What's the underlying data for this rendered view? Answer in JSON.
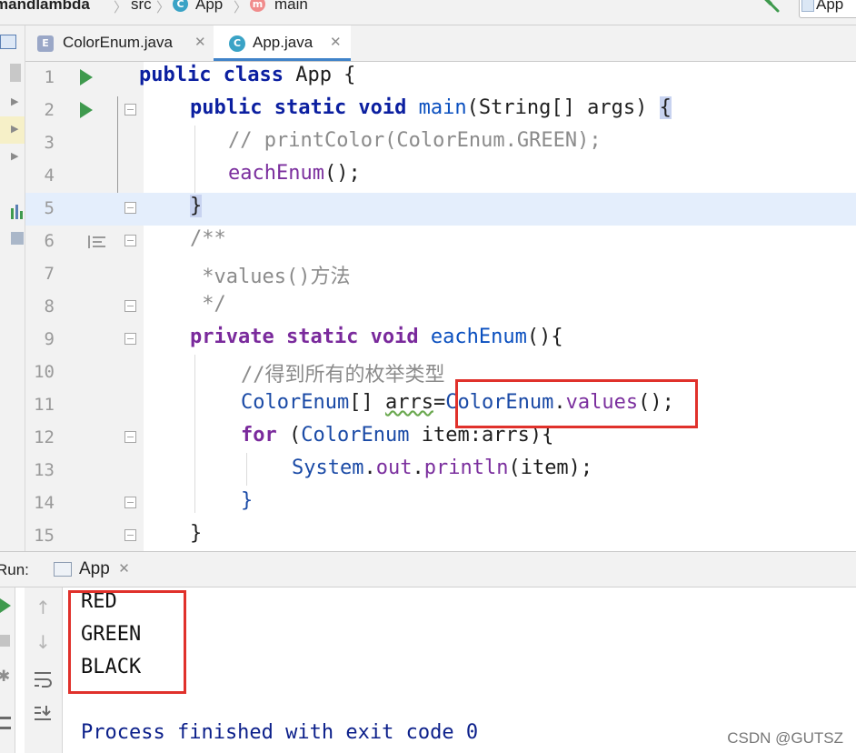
{
  "breadcrumb": {
    "items": [
      "mandlambda",
      "src",
      "App",
      "main"
    ]
  },
  "toolbar": {
    "run_config_label": "App"
  },
  "tabs": [
    {
      "label": "ColorEnum.java",
      "icon": "enum-icon",
      "active": false
    },
    {
      "label": "App.java",
      "icon": "class-icon",
      "active": true
    }
  ],
  "editor": {
    "lines": [
      {
        "n": "1"
      },
      {
        "n": "2"
      },
      {
        "n": "3"
      },
      {
        "n": "4"
      },
      {
        "n": "5"
      },
      {
        "n": "6"
      },
      {
        "n": "7"
      },
      {
        "n": "8"
      },
      {
        "n": "9"
      },
      {
        "n": "10"
      },
      {
        "n": "11"
      },
      {
        "n": "12"
      },
      {
        "n": "13"
      },
      {
        "n": "14"
      },
      {
        "n": "15"
      }
    ],
    "code": {
      "l1_kw": "public class",
      "l1_rest": " App {",
      "l2_kw": "public static void",
      "l2_fn": "main",
      "l2_rest": "(String[] args) ",
      "l2_brace": "{",
      "l3": "// printColor(ColorEnum.GREEN);",
      "l4_fn": "eachEnum",
      "l4_rest": "();",
      "l5": "}",
      "l6": "/**",
      "l7": " *values()方法",
      "l8": " */",
      "l9_kw": "private static void",
      "l9_fn": "eachEnum",
      "l9_rest": "(){",
      "l10": "//得到所有的枚举类型",
      "l11_type": "ColorEnum",
      "l11_a": "[] ",
      "l11_var": "arrs",
      "l11_b": "=",
      "l11_cls": "ColorEnum",
      "l11_dot": ".",
      "l11_m": "values",
      "l11_end": "();",
      "l12_kw": "for",
      "l12_a": " (",
      "l12_type": "ColorEnum",
      "l12_b": " item:arrs){",
      "l13_cls": "System",
      "l13_dot": ".",
      "l13_fld": "out",
      "l13_dot2": ".",
      "l13_m": "println",
      "l13_end": "(item);",
      "l14": "}",
      "l15": "}"
    }
  },
  "run_panel": {
    "label": "Run:",
    "tab_label": "App",
    "output": [
      "RED",
      "GREEN",
      "BLACK"
    ],
    "exit_message": "Process finished with exit code 0"
  },
  "watermark": "CSDN @GUTSZ",
  "colors": {
    "accent": "#4083c9",
    "highlight_box": "#e0312b",
    "run_green": "#3f9a4e"
  }
}
